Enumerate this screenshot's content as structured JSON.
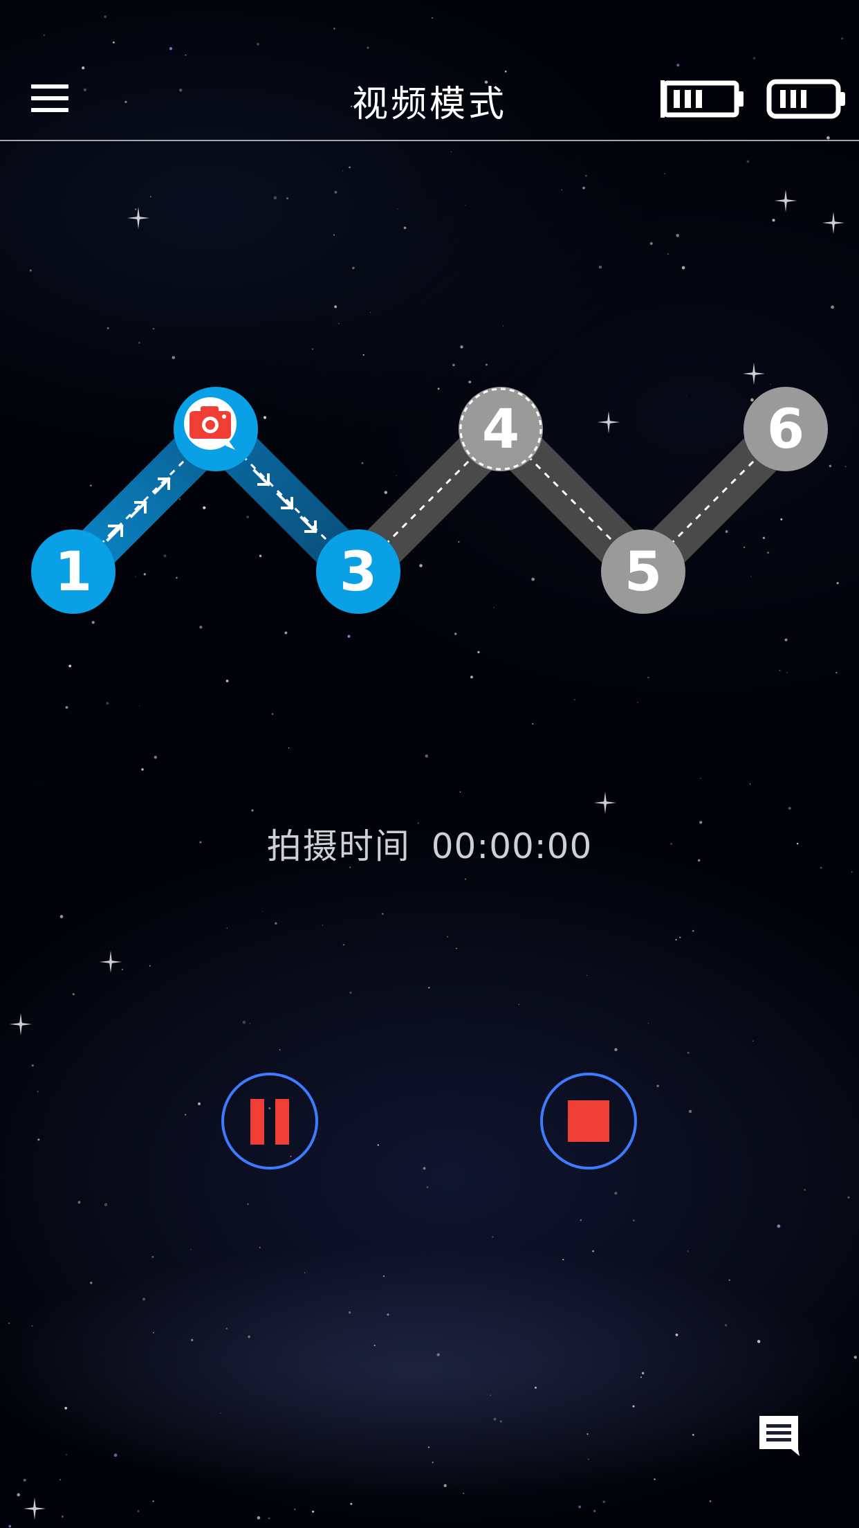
{
  "header": {
    "title": "视频模式",
    "menu_icon": "hamburger-menu-icon",
    "battery_icons": [
      "device-battery-icon",
      "phone-battery-icon"
    ]
  },
  "path": {
    "nodes": [
      {
        "label": "1",
        "state": "completed"
      },
      {
        "label": "",
        "state": "current",
        "icon": "camera-icon"
      },
      {
        "label": "3",
        "state": "completed"
      },
      {
        "label": "4",
        "state": "pending-dashed"
      },
      {
        "label": "5",
        "state": "pending"
      },
      {
        "label": "6",
        "state": "pending"
      }
    ]
  },
  "status": {
    "label": "拍摄时间",
    "value": "00:00:00"
  },
  "controls": {
    "pause_icon": "pause-icon",
    "stop_icon": "stop-icon"
  },
  "footer": {
    "chat_icon": "chat-icon"
  },
  "colors": {
    "active": "#0aa0e6",
    "inactive": "#9a9a9a",
    "accent_red": "#ef3e36",
    "button_ring": "#3d7bff"
  }
}
